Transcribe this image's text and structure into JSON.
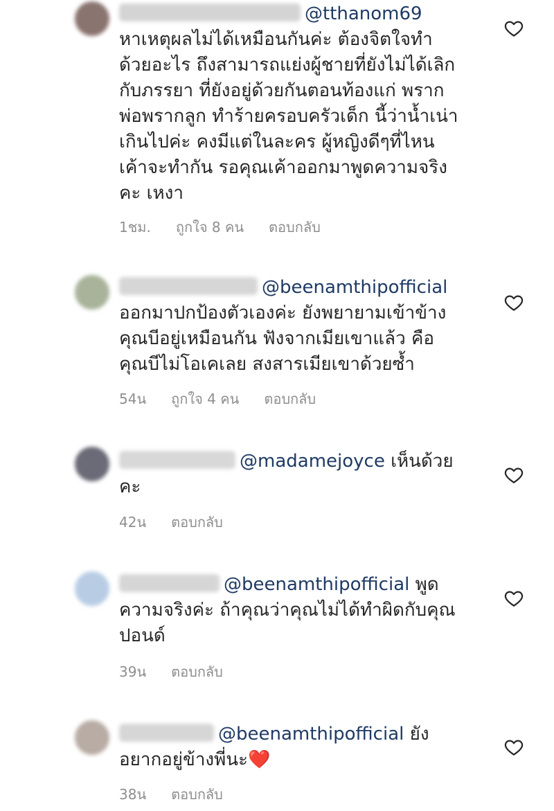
{
  "comments": [
    {
      "mention": "@tthanom69",
      "text_lines": [
        "หาเหตุผลไม่ได้เหมือนกันค่ะ ต้องจิตใจทำ",
        "ด้วยอะไร ถึงสามารถแย่งผู้ชายที่ยังไม่ได้เลิก",
        "กับภรรยา ที่ยังอยู่ด้วยกันตอนท้องแก่ พราก",
        "พ่อพรากลูก ทำร้ายครอบครัวเด็ก นี้ว่าน้ำเน่า",
        "เกินไปค่ะ คงมีแต่ในละคร ผู้หญิงดีๆที่ไหน",
        "เค้าจะทำกัน รอคุณเค้าออกมาพูดความจริง",
        "คะ เหงา"
      ],
      "time": "1ชม.",
      "likes": "ถูกใจ 8 คน",
      "reply": "ตอบกลับ"
    },
    {
      "mention": "@beenamthipofficial",
      "text_lines": [
        "ออกมาปกป้องตัวเองค่ะ ยังพยายามเข้าข้าง",
        "คุณบีอยู่เหมือนกัน ฟังจากเมียเขาแล้ว คือ",
        "คุณบีไม่โอเคเลย สงสารเมียเขาด้วยซ้ำ"
      ],
      "time": "54น",
      "likes": "ถูกใจ 4 คน",
      "reply": "ตอบกลับ"
    },
    {
      "mention": "@madamejoyce",
      "first_line_tail": " เห็นด้วย",
      "text_lines": [
        "คะ"
      ],
      "time": "42น",
      "reply": "ตอบกลับ"
    },
    {
      "mention": "@beenamthipofficial",
      "first_line_tail": " พูด",
      "text_lines": [
        "ความจริงค่ะ ถ้าคุณว่าคุณไม่ได้ทำผิดกับคุณ",
        "ปอนด์"
      ],
      "time": "39น",
      "reply": "ตอบกลับ"
    },
    {
      "mention": "@beenamthipofficial",
      "first_line_tail": " ยัง",
      "text_lines": [
        "อยากอยู่ข้างพี่นะ"
      ],
      "emoji": "❤️",
      "time": "38น",
      "reply": "ตอบกลับ"
    }
  ],
  "colors": {
    "mention": "#1f3a64",
    "meta": "#8e8e8e",
    "heart_outline": "#262626"
  },
  "icons": {
    "like": "heart-outline-icon"
  }
}
